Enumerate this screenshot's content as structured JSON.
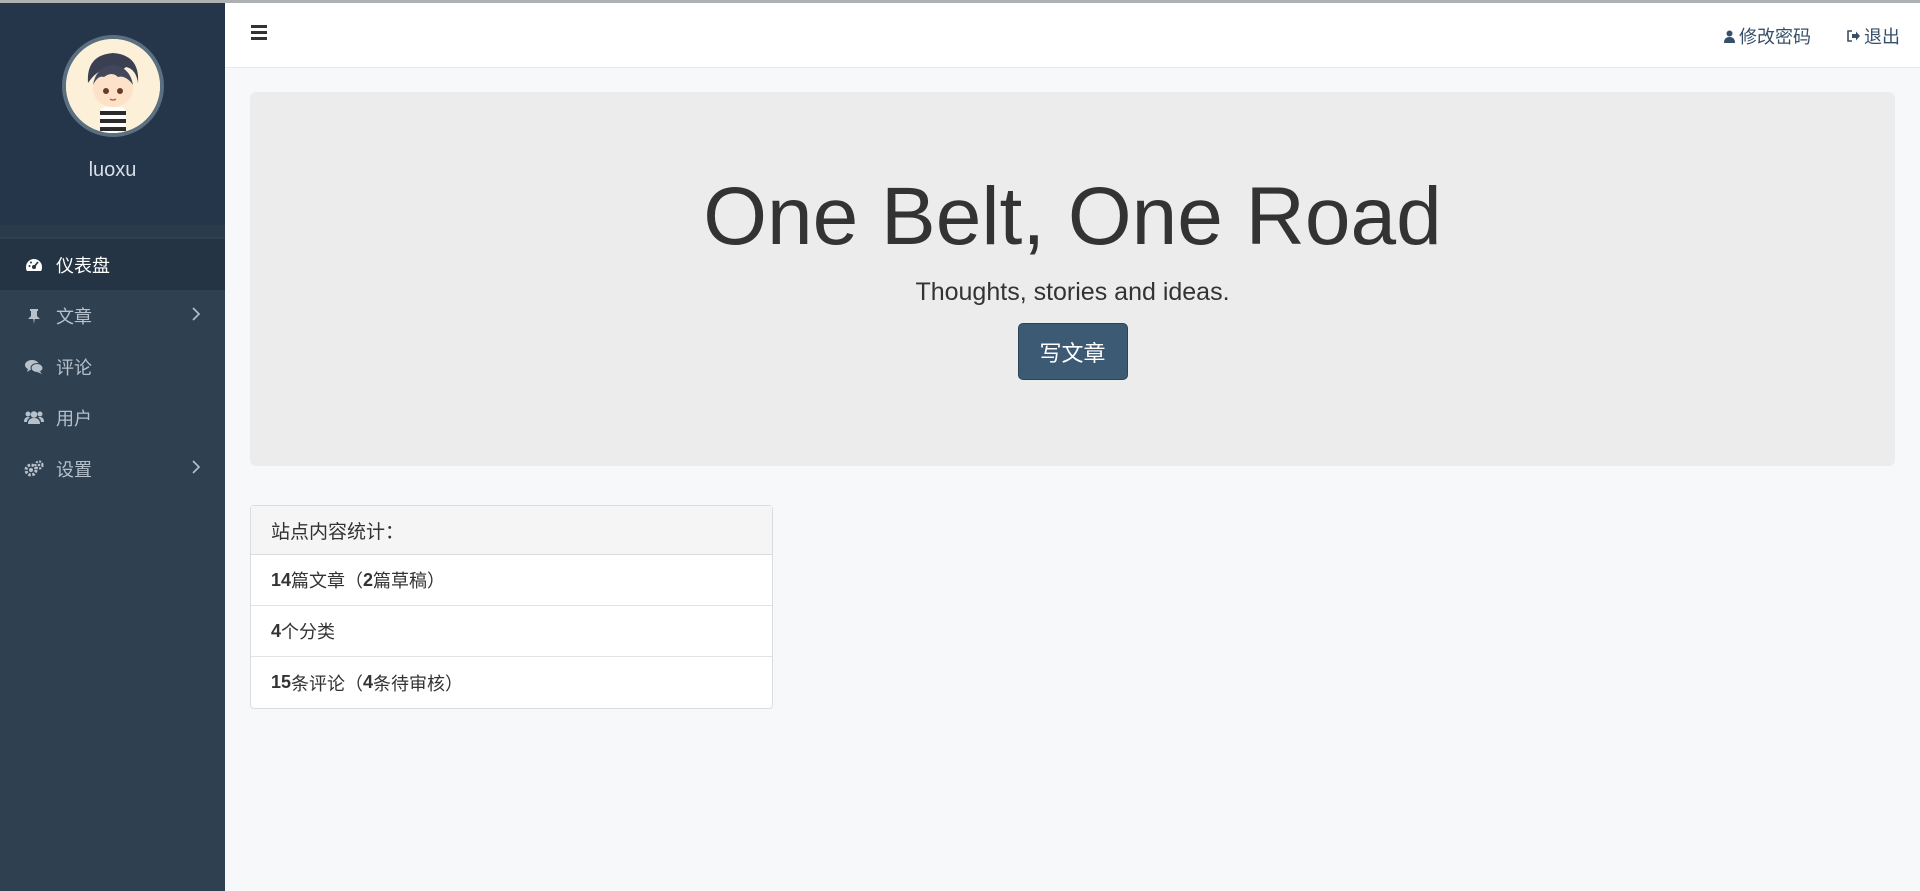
{
  "user": {
    "name": "luoxu"
  },
  "sidebar": {
    "items": [
      {
        "label": "仪表盘",
        "icon": "dashboard-icon",
        "active": true,
        "has_children": false
      },
      {
        "label": "文章",
        "icon": "thumbtack-icon",
        "active": false,
        "has_children": true
      },
      {
        "label": "评论",
        "icon": "comments-icon",
        "active": false,
        "has_children": false
      },
      {
        "label": "用户",
        "icon": "users-icon",
        "active": false,
        "has_children": false
      },
      {
        "label": "设置",
        "icon": "cogs-icon",
        "active": false,
        "has_children": true
      }
    ]
  },
  "navbar": {
    "change_password": "修改密码",
    "logout": "退出"
  },
  "jumbotron": {
    "title": "One Belt, One Road",
    "subtitle": "Thoughts, stories and ideas.",
    "button": "写文章"
  },
  "stats": {
    "heading": "站点内容统计：",
    "posts": {
      "count": "14",
      "label": "篇文章（",
      "drafts": "2",
      "drafts_label": "篇草稿）"
    },
    "categories": {
      "count": "4",
      "label": "个分类"
    },
    "comments": {
      "count": "15",
      "label": "条评论（",
      "pending": "4",
      "pending_label": "条待审核）"
    }
  },
  "colors": {
    "sidebar_bg": "#2f4050",
    "profile_bg": "#26364a",
    "primary_button": "#3d5a75",
    "jumbotron_bg": "#ececec"
  }
}
